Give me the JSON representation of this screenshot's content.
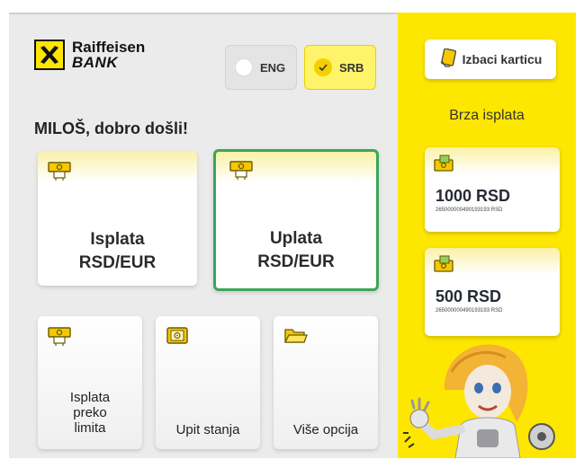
{
  "brand": {
    "line1": "Raiffeisen",
    "line2": "BANK"
  },
  "language": {
    "options": [
      {
        "code": "ENG",
        "selected": false
      },
      {
        "code": "SRB",
        "selected": true
      }
    ]
  },
  "greeting": "MILOŠ, dobro došli!",
  "main_tiles": [
    {
      "label_lines": [
        "Isplata",
        "RSD/EUR"
      ],
      "icon": "cash-withdrawal-icon",
      "selected": false
    },
    {
      "label_lines": [
        "Uplata",
        "RSD/EUR"
      ],
      "icon": "cash-deposit-icon",
      "selected": true
    }
  ],
  "small_tiles": [
    {
      "label_lines": [
        "Isplata",
        "preko",
        "limita"
      ],
      "icon": "cash-withdrawal-icon"
    },
    {
      "label_lines": [
        "Upit stanja"
      ],
      "icon": "safe-icon"
    },
    {
      "label_lines": [
        "Više opcija"
      ],
      "icon": "folder-icon"
    }
  ],
  "right_panel": {
    "eject_label": "Izbaci karticu",
    "fast_title": "Brza isplata",
    "fast_options": [
      {
        "amount": "1000 RSD",
        "account": "265000000490193193 RSD"
      },
      {
        "amount": "500 RSD",
        "account": "265000000490193193 RSD"
      }
    ]
  },
  "colors": {
    "brand_yellow": "#fde600",
    "selected_border": "#3aa65a",
    "panel_gray": "#ebebeb"
  }
}
